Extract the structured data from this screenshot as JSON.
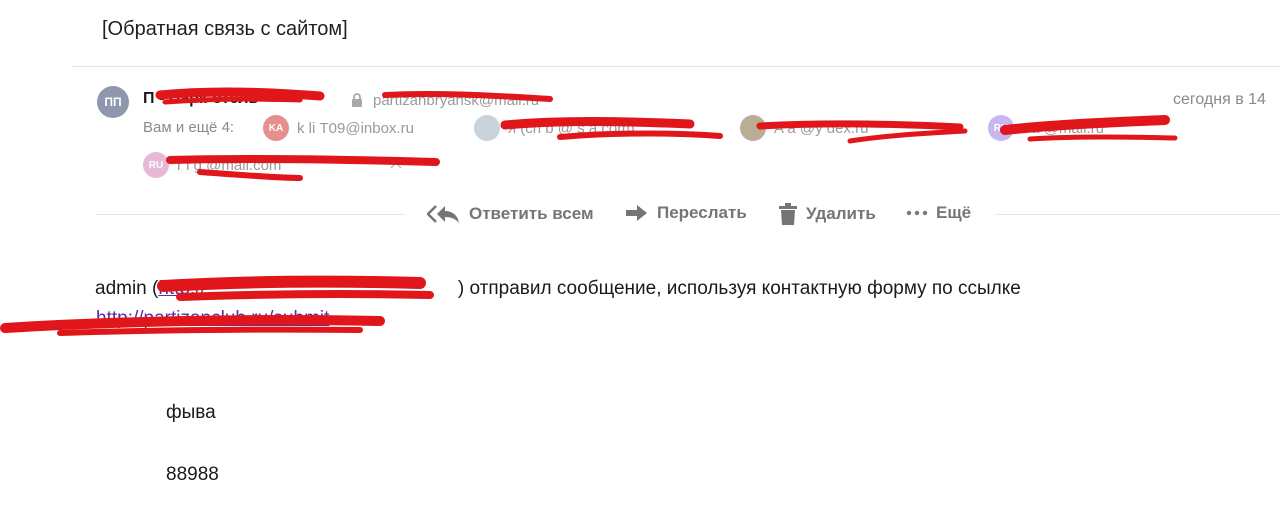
{
  "subject": "[Обратная связь с сайтом]",
  "sender": {
    "avatar_initials": "ПП",
    "name": "П        -  Парк-отель",
    "email": "partizanbryansk@mail.ru",
    "date": "сегодня в 14"
  },
  "recipients": {
    "label": "Вам и ещё 4:",
    "items": [
      {
        "initials": "KA",
        "address": "k   li     Т09@inbox.ru",
        "color": "#e58f8f"
      },
      {
        "initials": "",
        "address": "я (ch    b     @      s   a.com)",
        "color": "#c9d3dc"
      },
      {
        "initials": "",
        "address": "A         a        @y      dex.ru",
        "color": "#b9ad96"
      },
      {
        "initials": "RU",
        "address": "r          a      @mail.ru",
        "color": "#c8b6f0"
      },
      {
        "initials": "RU",
        "address": "r   l   g     @mail.com",
        "color": "#e7b8d8"
      }
    ]
  },
  "actions": {
    "reply_all": "Ответить всем",
    "forward": "Переслать",
    "delete": "Удалить",
    "more": "Ещё"
  },
  "body": {
    "line1_prefix": "admin (",
    "line1_link": "http://",
    "line1_suffix": ") отправил сообщение, используя контактную форму по ссылке",
    "url": "http://partizanclub.ru/submit",
    "fields": [
      "фыва",
      "88988"
    ]
  },
  "colors": {
    "redaction": "#e0161b",
    "link": "#5b2d9e",
    "muted": "#8a8a8a"
  }
}
